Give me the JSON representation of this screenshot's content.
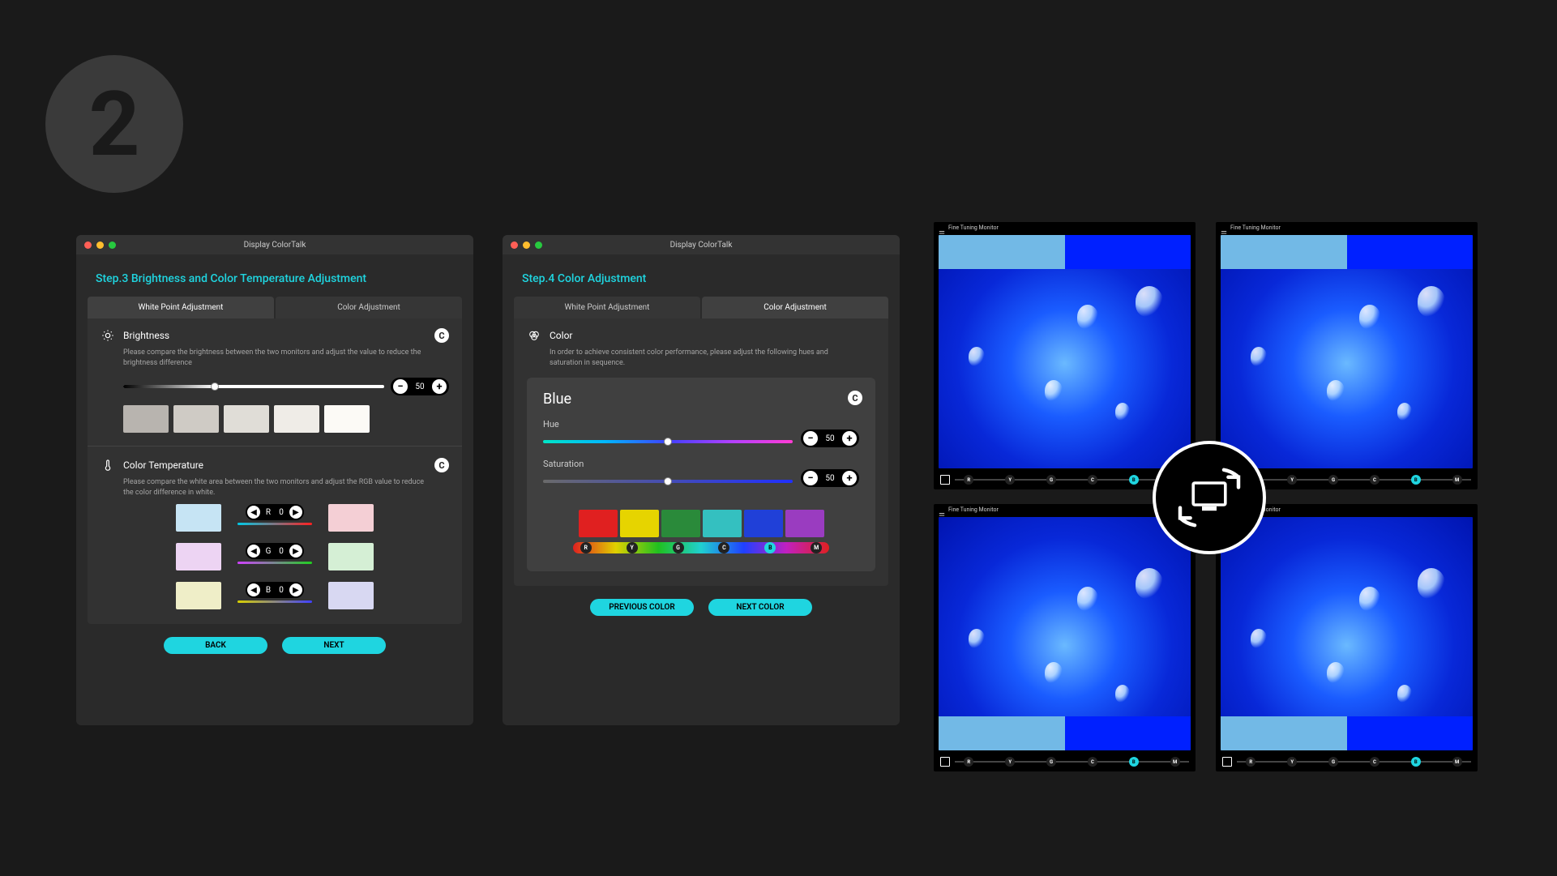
{
  "step_badge": "2",
  "window1": {
    "title": "Display ColorTalk",
    "step_title": "Step.3 Brightness and Color Temperature Adjustment",
    "tabs": {
      "left": "White Point Adjustment",
      "right": "Color Adjustment"
    },
    "brightness": {
      "title": "Brightness",
      "desc": "Please compare the brightness between the two monitors and adjust the value to reduce the brightness difference",
      "value": "50",
      "swatches": [
        "#b8b4af",
        "#cfcbc5",
        "#e0ddd7",
        "#efece7",
        "#fcfaf6"
      ]
    },
    "color_temp": {
      "title": "Color Temperature",
      "desc": "Please compare the white area between the two monitors and adjust the RGB value to reduce the color difference in white.",
      "rows": [
        {
          "ch": "R",
          "val": "0",
          "bar": "linear-gradient(90deg,#00c9e6,#ff2020)",
          "left": "#c6e4f4",
          "right": "#f4cfd5"
        },
        {
          "ch": "G",
          "val": "0",
          "bar": "linear-gradient(90deg,#d040ff,#20d020)",
          "left": "#edd4f3",
          "right": "#d5efd5"
        },
        {
          "ch": "B",
          "val": "0",
          "bar": "linear-gradient(90deg,#d8d000,#4040ff)",
          "left": "#efeec8",
          "right": "#d8d8f2"
        }
      ]
    },
    "buttons": {
      "back": "BACK",
      "next": "NEXT"
    }
  },
  "window2": {
    "title": "Display ColorTalk",
    "step_title": "Step.4 Color Adjustment",
    "tabs": {
      "left": "White Point Adjustment",
      "right": "Color Adjustment"
    },
    "color": {
      "title": "Color",
      "desc": "In order to achieve consistent color performance, please adjust the following hues and saturation in sequence.",
      "current": "Blue",
      "hue_label": "Hue",
      "hue_value": "50",
      "sat_label": "Saturation",
      "sat_value": "50",
      "swatches": [
        "#e02020",
        "#e6d400",
        "#2a8a3a",
        "#34c0c0",
        "#2040d8",
        "#9a3cc0"
      ],
      "spectrum_labels": [
        "R",
        "Y",
        "G",
        "C",
        "B",
        "M"
      ],
      "active_spectrum": "B"
    },
    "buttons": {
      "prev": "PREVIOUS COLOR",
      "next": "NEXT COLOR"
    }
  },
  "preview": {
    "title": "Fine Tuning Monitor",
    "spectrum_labels": [
      "R",
      "Y",
      "G",
      "C",
      "B",
      "M"
    ],
    "active": "B"
  }
}
